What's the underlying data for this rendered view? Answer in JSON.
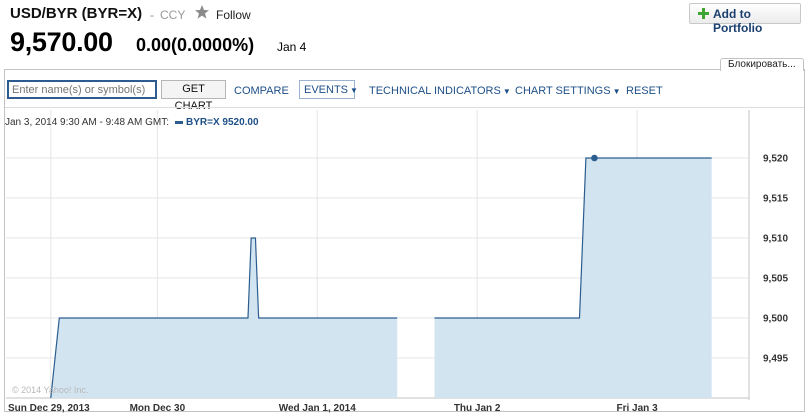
{
  "header": {
    "title": "USD/BYR (BYR=X)",
    "separator": "-",
    "exchange": "CCY",
    "follow_label": "Follow",
    "price": "9,570.00",
    "change": "0.00(0.0000%)",
    "date": "Jan 4",
    "add_portfolio_label": "Add to Portfolio",
    "lock_tab_label": "Блокировать..."
  },
  "toolbar": {
    "search_placeholder": "Enter name(s) or symbol(s)",
    "get_chart_label": "GET CHART",
    "compare_label": "COMPARE",
    "events_label": "EVENTS",
    "technical_label": "TECHNICAL INDICATORS",
    "settings_label": "CHART SETTINGS",
    "reset_label": "RESET"
  },
  "tooltip": {
    "range": "Jan 3, 2014 9:30 AM - 9:48 AM GMT:",
    "series_value": "BYR=X 9520.00"
  },
  "copyright": "© 2014 Yahoo! Inc.",
  "colors": {
    "line": "#2c5d8f",
    "fill": "#d3e4f1",
    "accent": "#1d4f87",
    "plus_icon": "#3fa535",
    "star_icon": "#8a8a8a"
  },
  "chart_data": {
    "type": "area",
    "series": [
      {
        "name": "BYR=X",
        "segments": [
          [
            [
              0.0,
              9490
            ],
            [
              0.08,
              9500
            ],
            [
              1.85,
              9500
            ],
            [
              1.88,
              9510
            ],
            [
              1.92,
              9510
            ],
            [
              1.95,
              9500
            ],
            [
              3.25,
              9500
            ]
          ],
          [
            [
              3.6,
              9500
            ],
            [
              4.96,
              9500
            ],
            [
              5.02,
              9520
            ],
            [
              6.2,
              9520
            ]
          ]
        ],
        "highlight_point": [
          5.1,
          9520
        ]
      }
    ],
    "x_ticks": [
      {
        "x": 0.0,
        "label": "Sun Dec 29, 2013"
      },
      {
        "x": 1.0,
        "label": "Mon Dec 30"
      },
      {
        "x": 2.5,
        "label": "Wed Jan 1, 2014"
      },
      {
        "x": 4.0,
        "label": "Thu Jan 2"
      },
      {
        "x": 5.5,
        "label": "Fri Jan 3"
      }
    ],
    "y_ticks": [
      9495,
      9500,
      9505,
      9510,
      9515,
      9520
    ],
    "y_labels": [
      "9,495",
      "9,500",
      "9,505",
      "9,510",
      "9,515",
      "9,520"
    ],
    "ylim": [
      9490,
      9526
    ],
    "xlim": [
      -0.42,
      6.55
    ],
    "grid": true
  }
}
